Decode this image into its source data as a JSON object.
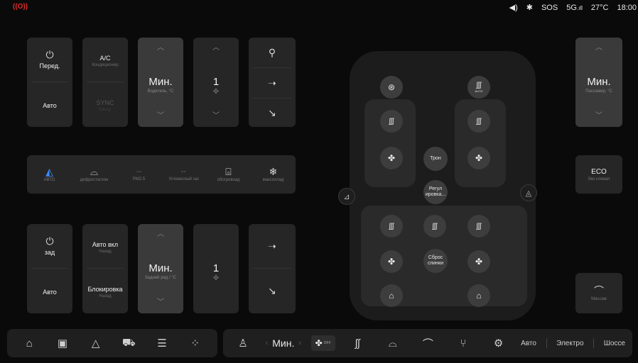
{
  "status": {
    "alert_icon": "((O))",
    "alert_color": "#e02b2b",
    "volume_icon": "speaker-icon",
    "bluetooth_icon": "bluetooth-icon",
    "sos": "SOS",
    "network": "5G",
    "temp": "27°C",
    "time": "18:00"
  },
  "front": {
    "power_label": "Перед.",
    "auto_label": "Авто",
    "ac_label": "A/C",
    "ac_sub": "Кондиционер",
    "sync_label": "SYNC",
    "sync_sub": "Синхр.",
    "driver_temp": "Мин.",
    "driver_temp_sub": "Водитель, °C",
    "fan_level": "1"
  },
  "mid_row": [
    {
      "label": "АВТО"
    },
    {
      "label": "дефростаглон"
    },
    {
      "value": "--",
      "label": "PM2.5"
    },
    {
      "value": "--",
      "label": "Углекислый газ"
    },
    {
      "label": "обогревзад"
    },
    {
      "label": "максохлад"
    }
  ],
  "rear": {
    "power_label": "зад",
    "auto_label": "Авто",
    "auto_on_label": "Авто вкл",
    "auto_on_sub": "Назад",
    "lock_label": "Блокировка",
    "lock_sub": "Назад",
    "temp": "Мин.",
    "temp_sub": "Задний ряд / °C",
    "fan_level": "1"
  },
  "right": {
    "passenger_temp": "Мин.",
    "passenger_temp_sub": "Пассажир, °C",
    "eco_label": "ECO",
    "eco_sub": "Эко климат",
    "massage_sub": "Массаж"
  },
  "car": {
    "throne": "Трон",
    "adjust": "Регул ировка...",
    "reset": "Сброс спинки",
    "auto_tag": "AUTO"
  },
  "dock": {
    "temp": "Мин.",
    "fan_off": "OFF",
    "modes": [
      "Авто",
      "Электро",
      "Шоссе"
    ]
  }
}
